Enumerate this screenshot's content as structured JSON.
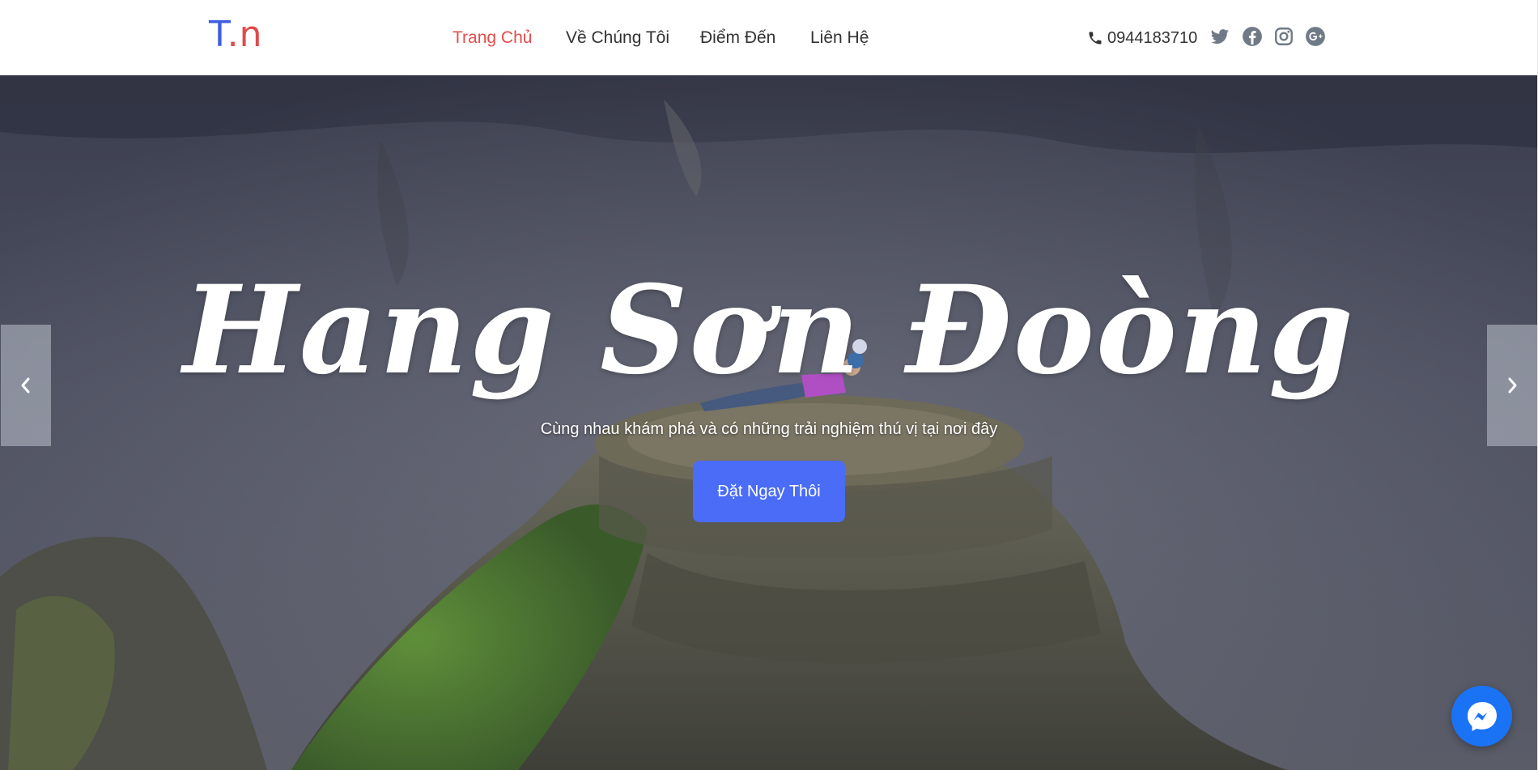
{
  "logo": {
    "t": "T",
    "dot": ".",
    "n": "n"
  },
  "nav": {
    "items": [
      {
        "label": "Trang Chủ",
        "active": true
      },
      {
        "label": "Về Chúng Tôi",
        "active": false
      },
      {
        "label": "Điểm Đến",
        "active": false
      },
      {
        "label": "Liên Hệ",
        "active": false
      }
    ]
  },
  "contact": {
    "phone": "0944183710",
    "icons": [
      "phone-icon",
      "twitter-icon",
      "facebook-icon",
      "instagram-icon",
      "google-plus-icon"
    ]
  },
  "hero": {
    "title": "Hang Sơn Đoòng",
    "subtitle": "Cùng nhau khám phá và có những trải nghiệm thú vị tại nơi đây",
    "cta_label": "Đặt Ngay Thôi"
  },
  "slider": {
    "prev_icon": "chevron-left-icon",
    "next_icon": "chevron-right-icon"
  },
  "chat": {
    "icon": "messenger-icon"
  },
  "colors": {
    "accent": "#e34c4c",
    "brand_blue": "#3f5fe0",
    "button": "#4a6cf7",
    "messenger": "#1a73f5"
  }
}
